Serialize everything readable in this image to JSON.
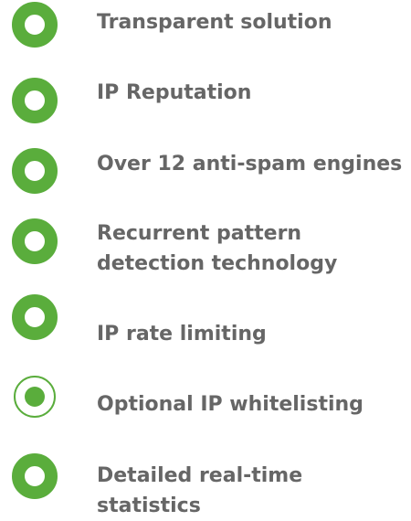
{
  "colors": {
    "accent": "#5aad3c",
    "text": "#666666"
  },
  "features": [
    {
      "icon": "ring-bullet-icon",
      "label": "Transparent solution"
    },
    {
      "icon": "ring-bullet-icon",
      "label": "IP Reputation"
    },
    {
      "icon": "ring-bullet-icon",
      "label": "Over 12 anti-spam engines"
    },
    {
      "icon": "ring-bullet-icon",
      "label": "Recurrent pattern detection technology"
    },
    {
      "icon": "ring-bullet-icon",
      "label": "IP rate limiting"
    },
    {
      "icon": "radio-selected-icon",
      "label": "Optional IP whitelisting"
    },
    {
      "icon": "ring-bullet-icon",
      "label": "Detailed real-time statistics"
    }
  ]
}
